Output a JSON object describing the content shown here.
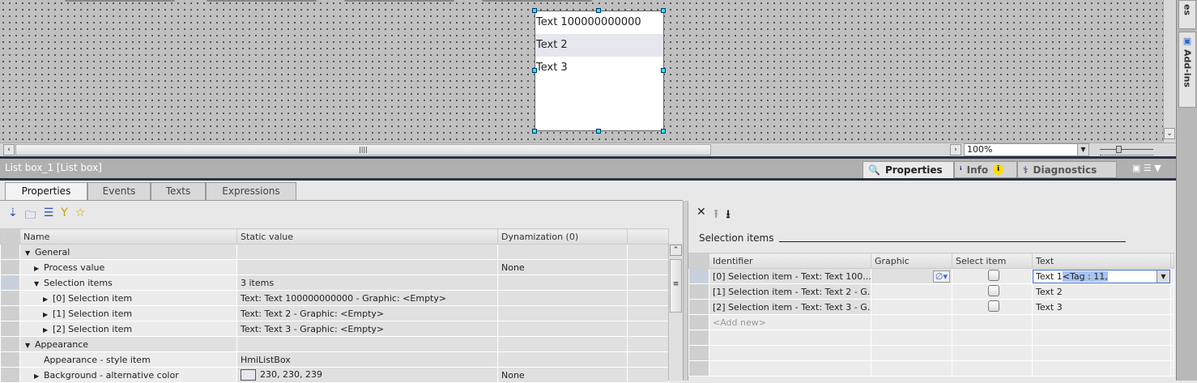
{
  "canvas": {
    "listbox_items": [
      "Text 100000000000",
      "Text 2",
      "Text 3"
    ]
  },
  "right_sidebar": {
    "tabs": [
      "es",
      "Add-ins"
    ]
  },
  "zoom": {
    "value": "100%"
  },
  "inspector": {
    "title": "List box_1 [List box]",
    "tabs": [
      "Properties",
      "Info",
      "Diagnostics"
    ]
  },
  "prop_tabs": [
    "Properties",
    "Events",
    "Texts",
    "Expressions"
  ],
  "prop_table": {
    "columns": [
      "Name",
      "Static value",
      "Dynamization (0)"
    ],
    "rows": [
      {
        "name": "General",
        "value": "",
        "dyn": "",
        "level": 0,
        "expand": "open"
      },
      {
        "name": "Process value",
        "value": "",
        "dyn": "None",
        "level": 1,
        "expand": "closed"
      },
      {
        "name": "Selection items",
        "value": "3 items",
        "dyn": "",
        "level": 1,
        "expand": "open"
      },
      {
        "name": "[0] Selection item",
        "value": "Text: Text 100000000000 - Graphic: <Empty>",
        "dyn": "",
        "level": 2,
        "expand": "closed"
      },
      {
        "name": "[1] Selection item",
        "value": "Text: Text 2 - Graphic: <Empty>",
        "dyn": "",
        "level": 2,
        "expand": "closed"
      },
      {
        "name": "[2] Selection item",
        "value": "Text: Text 3 - Graphic: <Empty>",
        "dyn": "",
        "level": 2,
        "expand": "closed"
      },
      {
        "name": "Appearance",
        "value": "",
        "dyn": "",
        "level": 0,
        "expand": "open"
      },
      {
        "name": "Appearance - style item",
        "value": "HmiListBox",
        "dyn": "",
        "level": 1,
        "expand": "none"
      },
      {
        "name": "Background - alternative color",
        "value": "230, 230, 239",
        "dyn": "None",
        "level": 1,
        "expand": "closed",
        "swatch": "#e6e6ef"
      }
    ]
  },
  "selection": {
    "heading": "Selection items",
    "columns": [
      "Identifier",
      "Graphic",
      "Select item",
      "Text"
    ],
    "rows": [
      {
        "id": "[0] Selection item - Text: Text 100...",
        "text_plain": "Text 1",
        "text_sel": "<Tag : 11,"
      },
      {
        "id": "[1] Selection item - Text: Text 2 - G...",
        "text": "Text 2"
      },
      {
        "id": "[2] Selection item - Text: Text 3 - G...",
        "text": "Text 3"
      }
    ],
    "add_new": "<Add new>"
  }
}
